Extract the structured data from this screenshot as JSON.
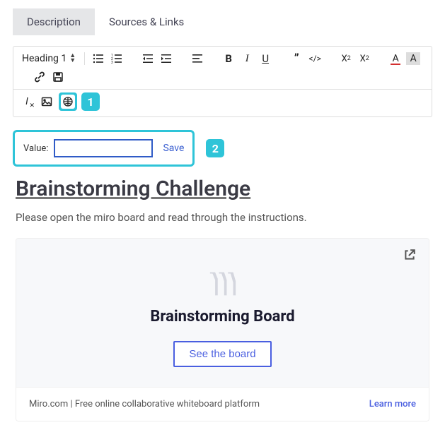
{
  "tabs": {
    "description": "Description",
    "sources": "Sources & Links"
  },
  "toolbar": {
    "heading_label": "Heading 1",
    "save_label": "Save"
  },
  "callouts": {
    "one": "1",
    "two": "2"
  },
  "value_row": {
    "label": "Value:",
    "input_value": ""
  },
  "content": {
    "heading": "Brainstorming Challenge",
    "instructions": "Please open the miro board and read through the instructions."
  },
  "embed": {
    "title": "Brainstorming Board",
    "button": "See the board",
    "footer": "Miro.com | Free online collaborative whiteboard platform",
    "learn_more": "Learn more"
  }
}
